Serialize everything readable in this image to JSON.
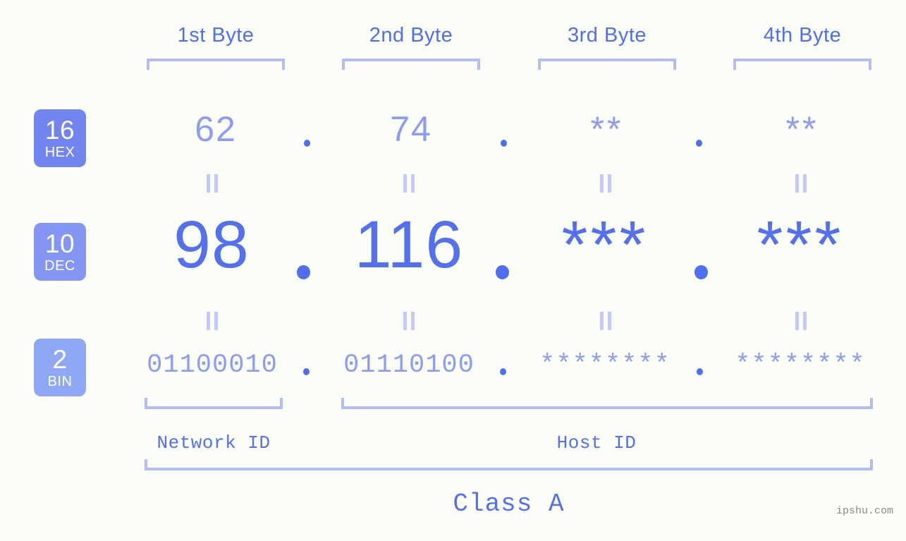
{
  "background_color": "#fbfdf7",
  "accent_color": "#5570ef",
  "accent_light": "#8c9cf3",
  "bracket_color": "#b3bcf8",
  "columns": [
    {
      "label": "1st Byte"
    },
    {
      "label": "2nd Byte"
    },
    {
      "label": "3rd Byte"
    },
    {
      "label": "4th Byte"
    }
  ],
  "bases": [
    {
      "number": "16",
      "name": "HEX",
      "color": "#7285ee"
    },
    {
      "number": "10",
      "name": "DEC",
      "color": "#8496f1"
    },
    {
      "number": "2",
      "name": "BIN",
      "color": "#8fa8f4"
    }
  ],
  "rows": {
    "hex": {
      "base_number": "16",
      "base_name": "HEX",
      "values": [
        "62",
        "74",
        "**",
        "**"
      ],
      "separator": "."
    },
    "dec": {
      "base_number": "10",
      "base_name": "DEC",
      "values": [
        "98",
        "116",
        "***",
        "***"
      ],
      "separator": "."
    },
    "bin": {
      "base_number": "2",
      "base_name": "BIN",
      "values": [
        "01100010",
        "01110100",
        "********",
        "********"
      ],
      "separator": "."
    }
  },
  "equality_marks": {
    "glyph": "||",
    "count_per_gap": 4
  },
  "sections": [
    {
      "name": "network_id",
      "label": "Network ID"
    },
    {
      "name": "host_id",
      "label": "Host ID"
    }
  ],
  "class": {
    "label": "Class A"
  },
  "watermark": {
    "text": "ipshu.com"
  },
  "chart_data": {
    "type": "table",
    "title": "IP Address Byte Breakdown - Class A",
    "columns": [
      "1st Byte",
      "2nd Byte",
      "3rd Byte",
      "4th Byte"
    ],
    "rows": [
      {
        "base": "16 HEX",
        "values": [
          "62",
          "74",
          "**",
          "**"
        ]
      },
      {
        "base": "10 DEC",
        "values": [
          "98",
          "116",
          "***",
          "***"
        ]
      },
      {
        "base": "2 BIN",
        "values": [
          "01100010",
          "01110100",
          "********",
          "********"
        ]
      }
    ],
    "network_id_bytes": [
      1
    ],
    "host_id_bytes": [
      2,
      3,
      4
    ],
    "ip_class": "Class A"
  }
}
